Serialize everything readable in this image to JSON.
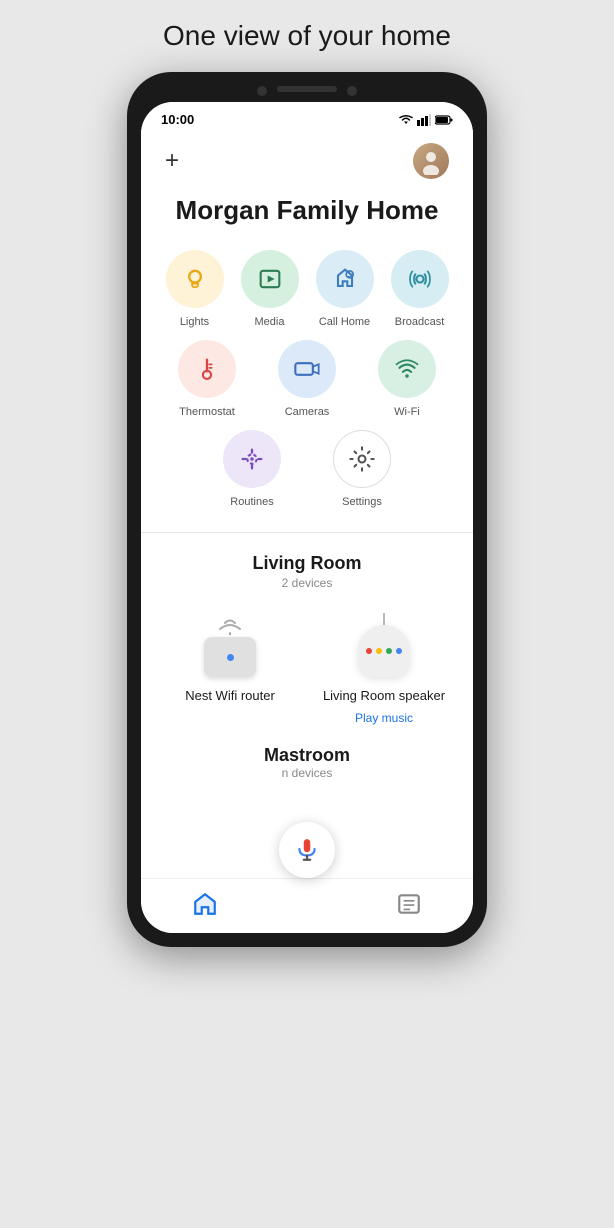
{
  "page": {
    "title": "One view of your home"
  },
  "status_bar": {
    "time": "10:00"
  },
  "header": {
    "add_label": "+",
    "home_title": "Morgan Family Home"
  },
  "shortcuts": {
    "row1": [
      {
        "id": "lights",
        "label": "Lights",
        "color": "yellow"
      },
      {
        "id": "media",
        "label": "Media",
        "color": "green"
      },
      {
        "id": "call-home",
        "label": "Call Home",
        "color": "blue"
      },
      {
        "id": "broadcast",
        "label": "Broadcast",
        "color": "teal"
      }
    ],
    "row2": [
      {
        "id": "thermostat",
        "label": "Thermostat",
        "color": "red"
      },
      {
        "id": "cameras",
        "label": "Cameras",
        "color": "blue2"
      },
      {
        "id": "wifi",
        "label": "Wi-Fi",
        "color": "green2"
      }
    ],
    "row3": [
      {
        "id": "routines",
        "label": "Routines",
        "color": "purple"
      },
      {
        "id": "settings",
        "label": "Settings",
        "color": "white"
      }
    ]
  },
  "living_room": {
    "title": "Living Room",
    "devices_count": "2 devices",
    "devices": [
      {
        "id": "nest-wifi",
        "name": "Nest Wifi router",
        "action": null
      },
      {
        "id": "living-room-speaker",
        "name": "Living Room speaker",
        "action": "Play music"
      }
    ]
  },
  "master_room": {
    "title": "Mast",
    "title_rest": "room",
    "devices_count": "n devices"
  },
  "bottom_nav": {
    "home_label": "Home",
    "list_label": "List"
  }
}
